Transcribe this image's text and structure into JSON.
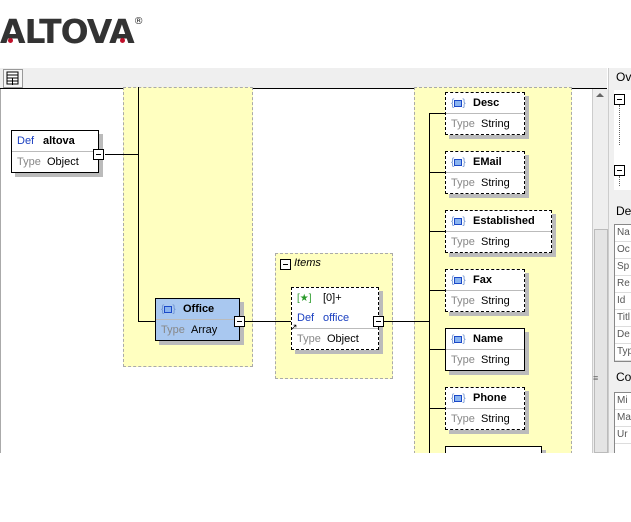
{
  "logo": {
    "text": "ALTOVA",
    "registered": "®"
  },
  "toolbar": {
    "icon": "diagram-toolbar-icon"
  },
  "diagram": {
    "root": {
      "prefix": "Def",
      "name": "altova",
      "type_label": "Type",
      "type": "Object"
    },
    "office": {
      "name": "Office",
      "type_label": "Type",
      "type": "Array"
    },
    "items": {
      "label": "Items",
      "occurrence": "[0]+",
      "prefix": "Def",
      "name": "office",
      "type_label": "Type",
      "type": "Object"
    },
    "properties": [
      {
        "name": "Desc",
        "type_label": "Type",
        "type": "String"
      },
      {
        "name": "EMail",
        "type_label": "Type",
        "type": "String"
      },
      {
        "name": "Established",
        "type_label": "Type",
        "type": "String"
      },
      {
        "name": "Fax",
        "type_label": "Type",
        "type": "String"
      },
      {
        "name": "Name",
        "type_label": "Type",
        "type": "String"
      },
      {
        "name": "Phone",
        "type_label": "Type",
        "type": "String"
      }
    ]
  },
  "right_panel": {
    "overview_title": "Ov",
    "details_title": "Det",
    "details_rows": [
      "Na",
      "Oc",
      "Sp",
      "Re",
      "Id",
      "Titl",
      "De",
      "Typ"
    ],
    "constraints_title": "Co",
    "constraints_rows": [
      "Mi",
      "Ma",
      "Ur"
    ]
  },
  "colors": {
    "selected_node": "#a9c8f0",
    "group_background": "#ffffc0",
    "def_text": "#1a3fc0",
    "logo_dot": "#c0102a"
  }
}
